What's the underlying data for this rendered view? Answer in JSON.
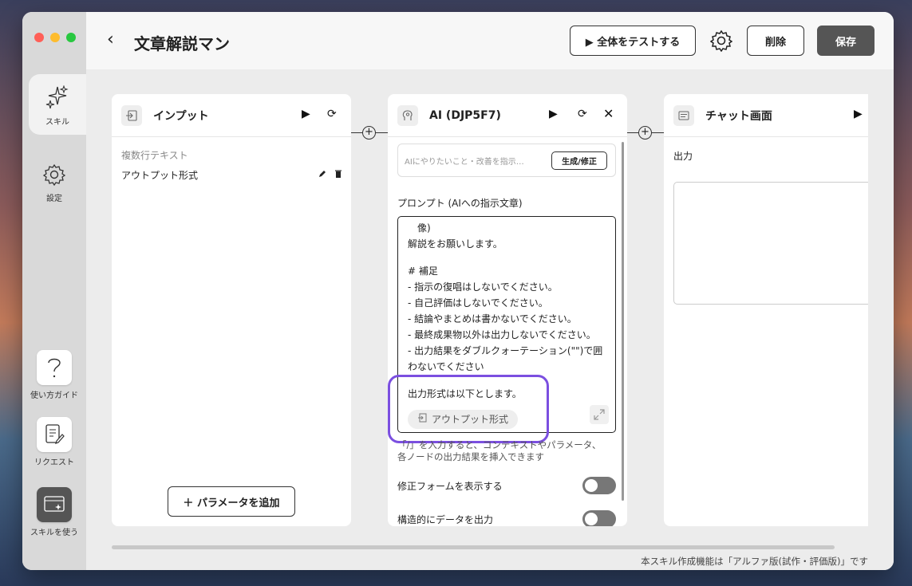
{
  "sidebar": {
    "items": [
      {
        "label": "スキル",
        "icon": "sparkles-icon"
      },
      {
        "label": "設定",
        "icon": "gear-icon"
      },
      {
        "label": "使い方ガイド",
        "icon": "question-icon"
      },
      {
        "label": "リクエスト",
        "icon": "document-edit-icon"
      },
      {
        "label": "スキルを使う",
        "icon": "skill-use-icon"
      }
    ]
  },
  "header": {
    "title": "文章解説マン",
    "test_all": "▶ 全体をテストする",
    "delete": "削除",
    "save": "保存"
  },
  "nodes": {
    "input": {
      "title": "インプット",
      "section_label": "複数行テキスト",
      "param": "アウトプット形式",
      "add_param": "＋ パラメータを追加"
    },
    "ai": {
      "title": "AI (DJP5F7)",
      "instruction_placeholder": "AIにやりたいこと・改善を指示…",
      "generate": "生成/修正",
      "prompt_label": "プロンプト (AIへの指示文章)",
      "prompt_lines": [
        "像)",
        "解説をお願いします。",
        "",
        "# 補足",
        "- 指示の復唱はしないでください。",
        "- 自己評価はしないでください。",
        "- 結論やまとめは書かないでください。",
        "- 最終成果物以外は出力しないでください。",
        "- 出力結果をダブルクォーテーション(\"\")で囲",
        "わないでください",
        "",
        "出力形式は以下とします。"
      ],
      "chip": "アウトプット形式",
      "hint_line1": "「/」を入力すると、コンテキストやパラメータ、",
      "hint_line2": "各ノードの出力結果を挿入できます",
      "option1": "修正フォームを表示する",
      "option2": "構造的にデータを出力"
    },
    "chat": {
      "title": "チャット画面",
      "output_label": "出力"
    }
  },
  "footer": {
    "note": "本スキル作成機能は「アルファ版(試作・評価版)」です"
  },
  "colors": {
    "highlight": "#7b4fe0",
    "save_bg": "#555555",
    "sidebar_bg": "#d9d9d9"
  }
}
